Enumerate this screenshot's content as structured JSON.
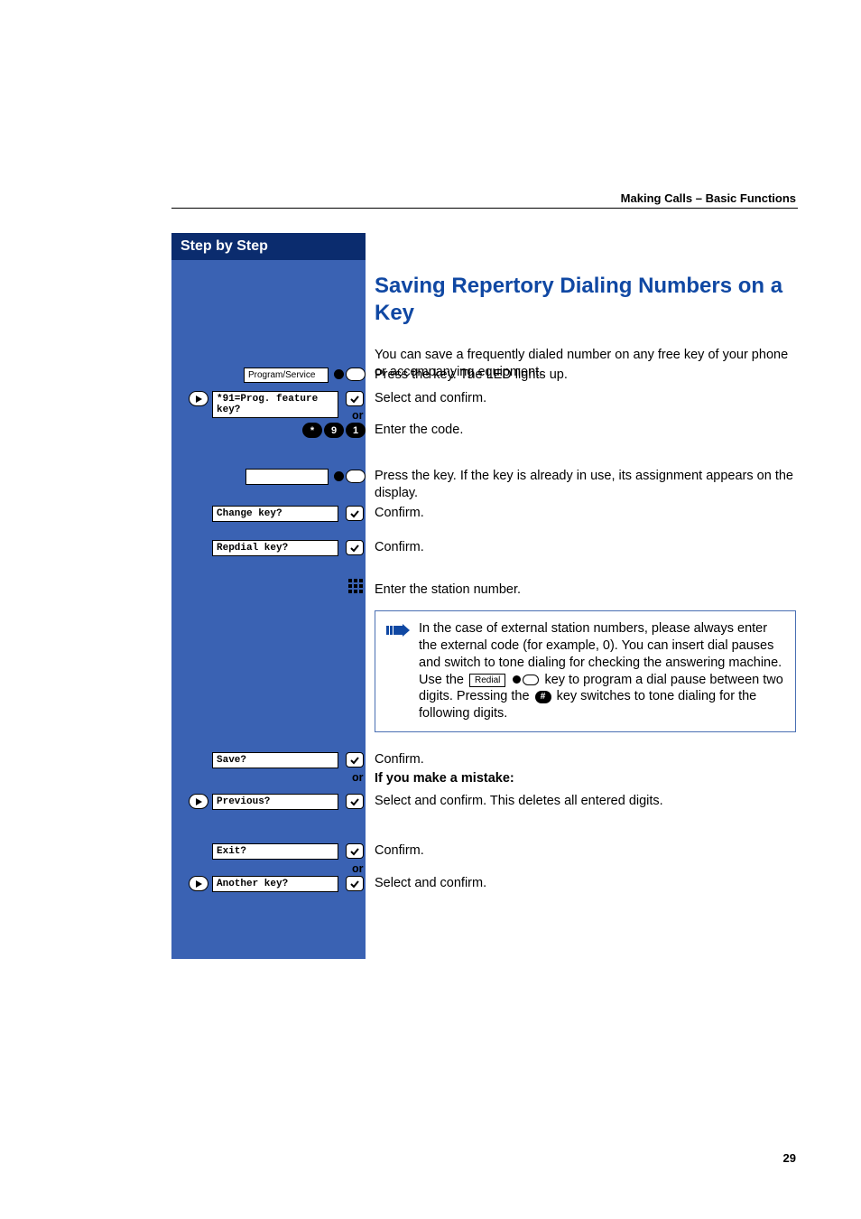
{
  "breadcrumb": "Making Calls – Basic Functions",
  "sidebar_title": "Step by Step",
  "heading": "Saving Repertory Dialing Numbers on a Key",
  "intro": "You can save a frequently dialed number on any free key of your phone or accompanying equipment.",
  "program_service_label": "Program/Service",
  "text_press_led": "Press the key. The LED lights up.",
  "prompt_prog_feature": "*91=Prog. feature key?",
  "text_select_confirm": "Select and confirm.",
  "or_label": "or",
  "code_keys": [
    "*",
    "9",
    "1"
  ],
  "text_enter_code": "Enter the code.",
  "text_press_key_inuse": "Press the key. If the key is already in use, its assignment appears on the display.",
  "prompt_change_key": "Change key?",
  "text_confirm": "Confirm.",
  "prompt_repdial_key": "Repdial key?",
  "text_enter_station": "Enter the station number.",
  "note": {
    "t1": "In the case of external station numbers, please always enter the external code (for example, 0). You can insert dial pauses and switch to tone dialing for checking the answering machine.",
    "t2a": "Use the",
    "redial_label": "Redial",
    "t2b": "key to program a dial pause between two digits. Pressing the",
    "t2c": "key switches to tone dialing for the following digits."
  },
  "prompt_save": "Save?",
  "mistake_heading": "If you make a mistake:",
  "prompt_previous": "Previous?",
  "text_select_confirm_delete": "Select and confirm. This deletes all entered digits.",
  "prompt_exit": "Exit?",
  "prompt_another_key": "Another key?",
  "page_number": "29"
}
